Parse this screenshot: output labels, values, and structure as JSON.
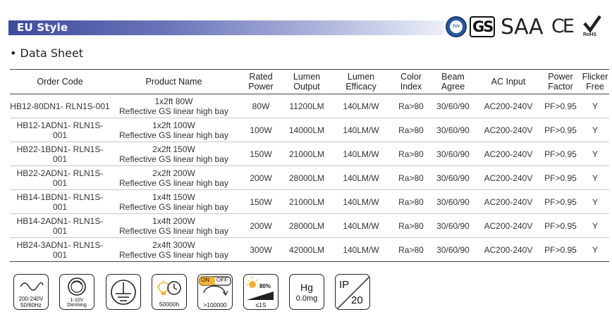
{
  "banner": {
    "title": "EU Style"
  },
  "certs": {
    "tuv": "TÜV",
    "gs": "GS",
    "saa": "SAA",
    "ce": "CE",
    "rohs": "RoHS"
  },
  "section": {
    "title": "• Data Sheet"
  },
  "table": {
    "headers": [
      "Order Code",
      "Product Name",
      "Rated\nPower",
      "Lumen\nOutput",
      "Lumen\nEfficacy",
      "Color\nIndex",
      "Beam\nAgree",
      "AC Input",
      "Power\nFactor",
      "Flicker\nFree"
    ],
    "rows": [
      {
        "code": "HB12-80DN1- RLN1S-001",
        "name1": "1x2ft 80W",
        "name2": "Reflective GS linear high bay",
        "power": "80W",
        "lumen": "11200LM",
        "efficacy": "140LM/W",
        "cri": "Ra>80",
        "beam": "30/60/90",
        "input": "AC200-240V",
        "pf": "PF>0.95",
        "flicker": "Y"
      },
      {
        "code": "HB12-1ADN1- RLN1S-001",
        "name1": "1x2ft 100W",
        "name2": "Reflective GS linear high bay",
        "power": "100W",
        "lumen": "14000LM",
        "efficacy": "140LM/W",
        "cri": "Ra>80",
        "beam": "30/60/90",
        "input": "AC200-240V",
        "pf": "PF>0.95",
        "flicker": "Y"
      },
      {
        "code": "HB22-1BDN1- RLN1S-001",
        "name1": "2x2ft 150W",
        "name2": "Reflective GS linear high bay",
        "power": "150W",
        "lumen": "21000LM",
        "efficacy": "140LM/W",
        "cri": "Ra>80",
        "beam": "30/60/90",
        "input": "AC200-240V",
        "pf": "PF>0.95",
        "flicker": "Y"
      },
      {
        "code": "HB22-2ADN1- RLN1S-001",
        "name1": "2x2ft 200W",
        "name2": "Reflective GS linear high bay",
        "power": "200W",
        "lumen": "28000LM",
        "efficacy": "140LM/W",
        "cri": "Ra>80",
        "beam": "30/60/90",
        "input": "AC200-240V",
        "pf": "PF>0.95",
        "flicker": "Y"
      },
      {
        "code": "HB14-1BDN1- RLN1S-001",
        "name1": "1x4ft 150W",
        "name2": "Reflective GS linear high bay",
        "power": "150W",
        "lumen": "21000LM",
        "efficacy": "140LM/W",
        "cri": "Ra>80",
        "beam": "30/60/90",
        "input": "AC200-240V",
        "pf": "PF>0.95",
        "flicker": "Y"
      },
      {
        "code": "HB14-2ADN1- RLN1S-001",
        "name1": "1x4ft 200W",
        "name2": "Reflective GS linear high bay",
        "power": "200W",
        "lumen": "28000LM",
        "efficacy": "140LM/W",
        "cri": "Ra>80",
        "beam": "30/60/90",
        "input": "AC200-240V",
        "pf": "PF>0.95",
        "flicker": "Y"
      },
      {
        "code": "HB24-3ADN1- RLN1S-001",
        "name1": "2x4ft 300W",
        "name2": "Reflective GS linear high bay",
        "power": "300W",
        "lumen": "42000LM",
        "efficacy": "140LM/W",
        "cri": "Ra>80",
        "beam": "30/60/90",
        "input": "AC200-240V",
        "pf": "PF>0.95",
        "flicker": "Y"
      }
    ]
  },
  "icons": {
    "voltage": {
      "icon": "sine-wave-icon",
      "line1": "200-240V",
      "line2": "50/60Hz"
    },
    "dimming": {
      "icon": "dimmer-knob-icon",
      "line1": "1-10V",
      "line2": "Dimming"
    },
    "ground": {
      "icon": "ground-symbol-icon"
    },
    "lifetime": {
      "icon": "bulb-clock-icon",
      "label": "50000h"
    },
    "switching": {
      "icon": "on-off-switch-icon",
      "on": "ON",
      "off": "OFF",
      "label": ">100000"
    },
    "startup": {
      "icon": "instant-start-icon",
      "percent": "80%",
      "time": "≤1S"
    },
    "mercury": {
      "icon": "mercury-icon",
      "symbol": "Hg",
      "value": "0.0mg"
    },
    "ip": {
      "icon": "ip-rating-icon",
      "prefix": "IP",
      "value": "20"
    }
  },
  "colors": {
    "banner_start": "#3e4c9c",
    "banner_end": "#eceef8",
    "tuv_blue": "#2c5aa0",
    "lamp_yellow": "#f2b233"
  }
}
